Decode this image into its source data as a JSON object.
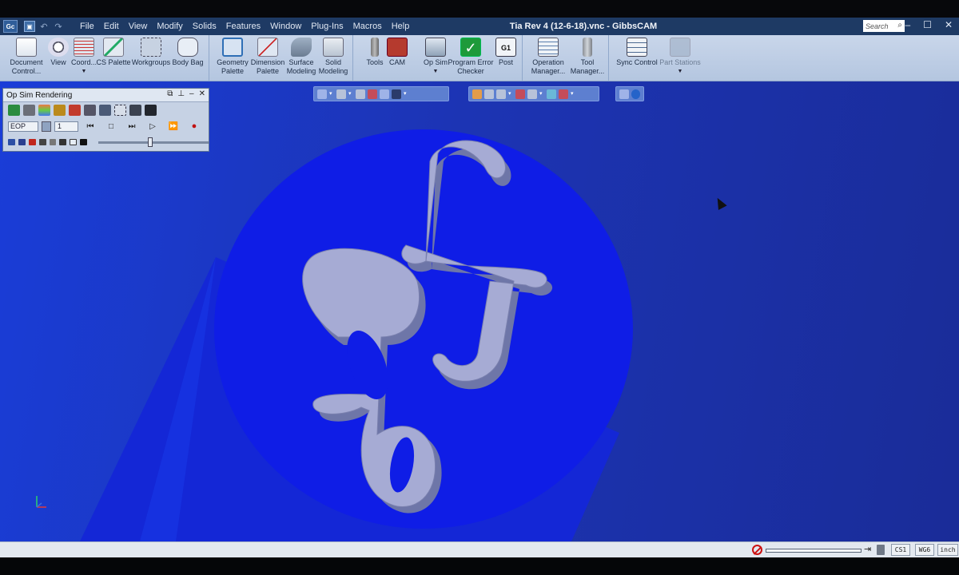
{
  "window": {
    "app_badge": "Gc",
    "title": "Tia Rev 4 (12-6-18).vnc - GibbsCAM",
    "search_placeholder": "Search",
    "controls": [
      "–",
      "☐",
      "✕"
    ]
  },
  "menu": [
    "File",
    "Edit",
    "View",
    "Modify",
    "Solids",
    "Features",
    "Window",
    "Plug-Ins",
    "Macros",
    "Help"
  ],
  "ribbon": {
    "buttons": [
      {
        "label": "Document Control...",
        "icon": "document-icon",
        "has_dropdown": false
      },
      {
        "label": "View",
        "icon": "view-icon",
        "has_dropdown": false
      },
      {
        "label": "Coord...",
        "icon": "coordinate-icon",
        "has_dropdown": true
      },
      {
        "label": "CS Palette",
        "icon": "cs-palette-icon",
        "has_dropdown": false
      },
      {
        "label": "Workgroups",
        "icon": "workgroups-icon",
        "has_dropdown": false
      },
      {
        "label": "Body Bag",
        "icon": "body-bag-icon",
        "has_dropdown": false
      },
      {
        "label": "Geometry Palette",
        "icon": "geometry-icon",
        "has_dropdown": false
      },
      {
        "label": "Dimension Palette",
        "icon": "dimension-icon",
        "has_dropdown": false
      },
      {
        "label": "Surface Modeling",
        "icon": "surface-icon",
        "has_dropdown": false
      },
      {
        "label": "Solid Modeling",
        "icon": "solid-icon",
        "has_dropdown": false
      },
      {
        "label": "Tools",
        "icon": "tools-icon",
        "has_dropdown": false
      },
      {
        "label": "CAM",
        "icon": "cam-icon",
        "has_dropdown": false
      },
      {
        "label": "Op Sim",
        "icon": "op-sim-icon",
        "has_dropdown": true
      },
      {
        "label": "Program Error Checker",
        "icon": "check-icon",
        "has_dropdown": false
      },
      {
        "label": "Post",
        "icon": "post-icon",
        "has_dropdown": false
      },
      {
        "label": "Operation Manager...",
        "icon": "operation-manager-icon",
        "has_dropdown": false
      },
      {
        "label": "Tool Manager...",
        "icon": "tool-manager-icon",
        "has_dropdown": false
      },
      {
        "label": "Sync Control",
        "icon": "sync-icon",
        "has_dropdown": false
      },
      {
        "label": "Part Stations",
        "icon": "part-stations-icon",
        "has_dropdown": true,
        "disabled": true
      }
    ]
  },
  "palette": {
    "title": "Op Sim Rendering",
    "stop_field": "EOP",
    "step_value": "1",
    "transport": [
      "⏮",
      "□",
      "⏭",
      "▷",
      "⏩",
      "●"
    ],
    "slider_level": 0.45
  },
  "status": {
    "cells": [
      "CS1",
      "WG6",
      "inch"
    ],
    "progress": 0
  },
  "colors": {
    "viewport": "#1c34b4",
    "stock_top": "#0d1be0",
    "part": "#a3a9d0",
    "ribbon": "#c2d0e6",
    "titlebar": "#1e3a64"
  }
}
